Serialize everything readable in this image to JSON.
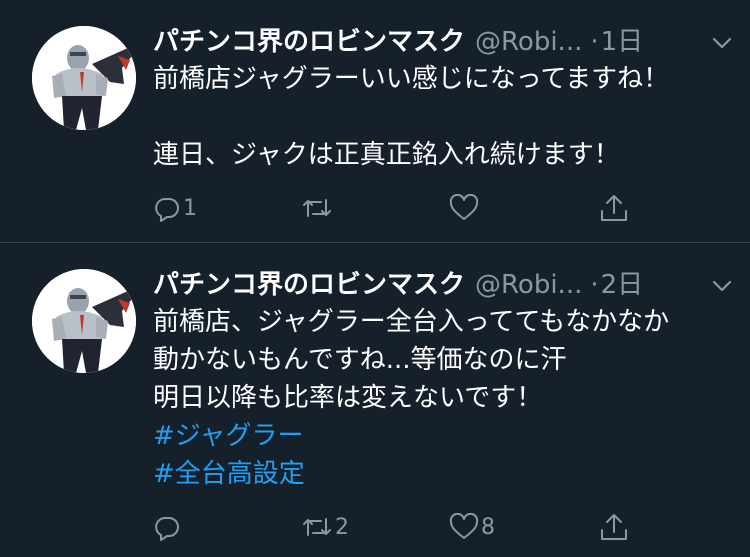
{
  "colors": {
    "background": "#15202b",
    "divider": "#38444d",
    "text_primary": "#ffffff",
    "text_secondary": "#8899a6",
    "hashtag": "#1da1f2"
  },
  "tweets": [
    {
      "avatar_icon": "masked-wrestler-avatar",
      "display_name": "パチンコ界のロビンマスク",
      "handle": "@Robi...",
      "dot": "·",
      "time": "1日",
      "text_lines": [
        "前橋店ジャグラーいい感じになってますね！",
        "",
        "連日、ジャクは正真正銘入れ続けます！"
      ],
      "hashtags": [],
      "reply_count": "1",
      "retweet_count": "",
      "like_count": ""
    },
    {
      "avatar_icon": "masked-wrestler-avatar",
      "display_name": "パチンコ界のロビンマスク",
      "handle": "@Robi...",
      "dot": "·",
      "time": "2日",
      "text_lines": [
        "前橋店、ジャグラー全台入っててもなかなか",
        "動かないもんですね...等価なのに汗",
        "明日以降も比率は変えないです！"
      ],
      "hashtags": [
        "#ジャグラー",
        "#全台高設定"
      ],
      "reply_count": "",
      "retweet_count": "2",
      "like_count": "8"
    }
  ]
}
